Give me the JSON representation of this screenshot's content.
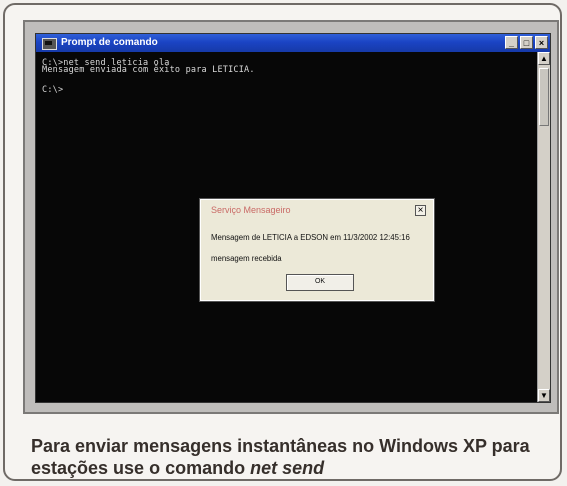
{
  "window": {
    "title": "Prompt de comando",
    "controls": [
      "_",
      "□",
      "×"
    ],
    "icon": "console-icon"
  },
  "console": {
    "lines": [
      "C:\\>net send leticia ola",
      "Mensagem enviada com êxito para LETICIA.",
      "C:\\>"
    ]
  },
  "dialog": {
    "title": "Serviço Mensageiro",
    "message": "Mensagem de LETICIA a EDSON em 11/3/2002 12:45:16",
    "status": "mensagem recebida",
    "ok_label": "OK",
    "close_label": "×"
  },
  "caption": {
    "text": "Para enviar mensagens instantâneas no Windows XP para estações use o comando ",
    "command": "net send"
  }
}
